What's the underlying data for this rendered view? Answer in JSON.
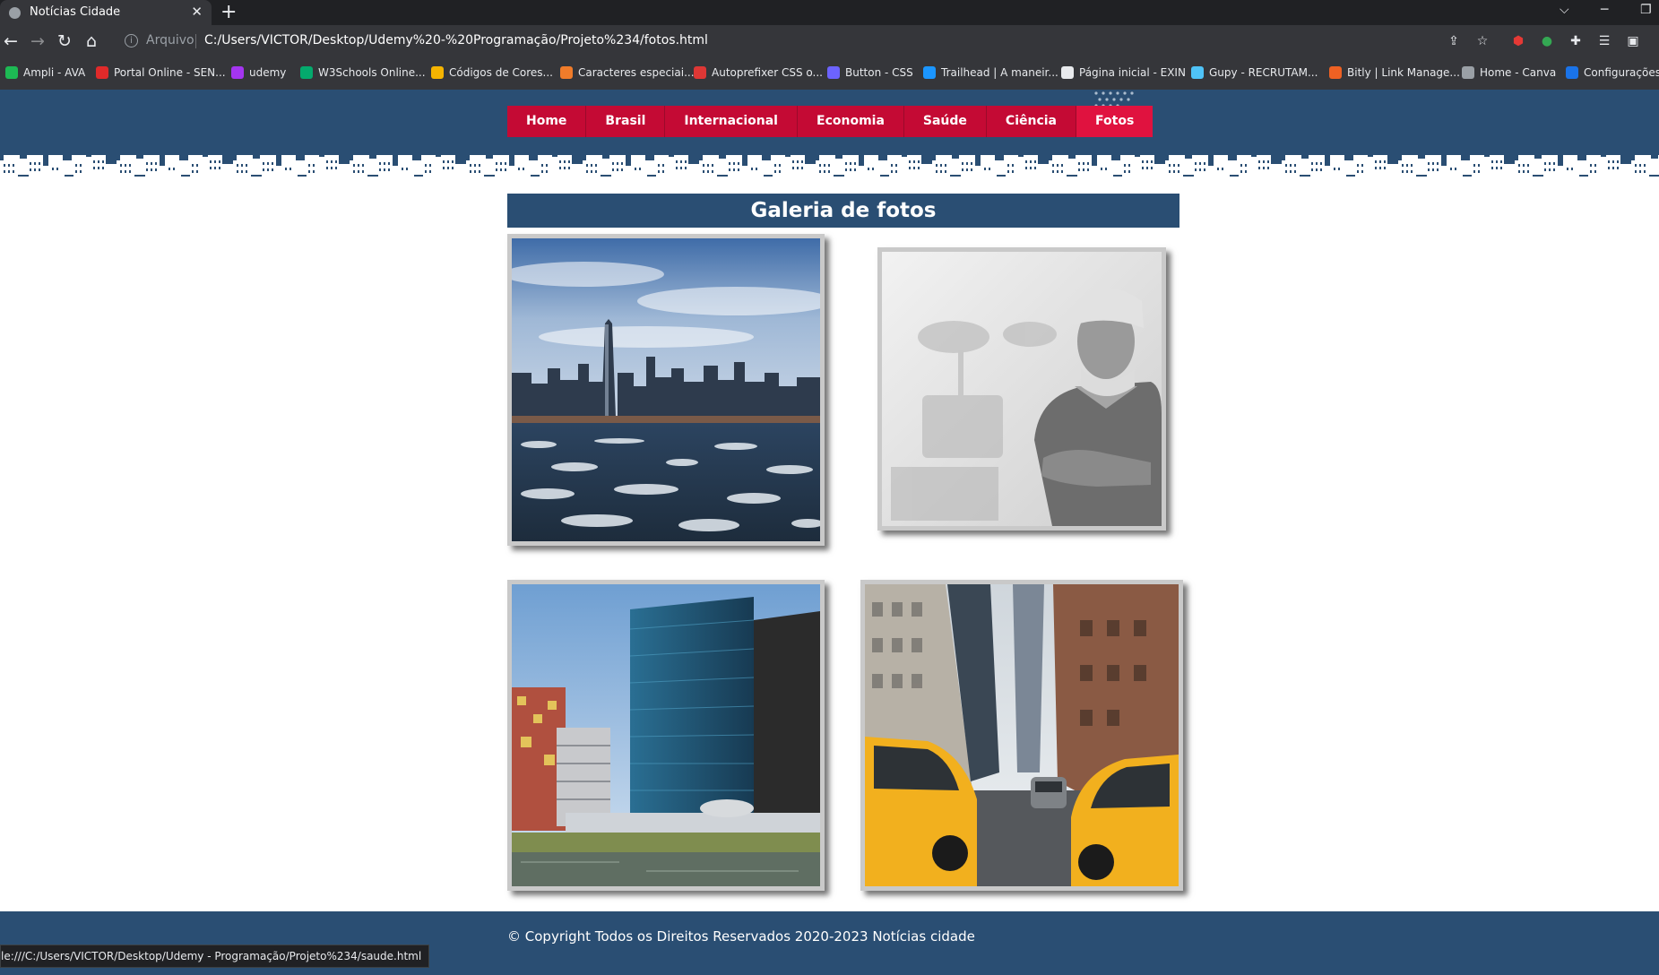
{
  "browser": {
    "tab_title": "Notícias Cidade",
    "tab_close": "✕",
    "new_tab": "+",
    "address_label": "Arquivo",
    "address_url": "C:/Users/VICTOR/Desktop/Udemy%20-%20Programação/Projeto%234/fotos.html",
    "status_url": "le:///C:/Users/VICTOR/Desktop/Udemy - Programação/Projeto%234/saude.html",
    "bookmarks": [
      {
        "label": "Ampli - AVA",
        "color": "#1db954"
      },
      {
        "label": "Portal Online - SEN...",
        "color": "#e02a2a"
      },
      {
        "label": "udemy",
        "color": "#a435f0"
      },
      {
        "label": "W3Schools Online...",
        "color": "#04aa6d"
      },
      {
        "label": "Códigos de Cores...",
        "color": "#f5b400"
      },
      {
        "label": "Caracteres especiai...",
        "color": "#f07c2a"
      },
      {
        "label": "Autoprefixer CSS o...",
        "color": "#dd3735"
      },
      {
        "label": "Button - CSS",
        "color": "#6c63ff"
      },
      {
        "label": "Trailhead | A maneir...",
        "color": "#1b96ff"
      },
      {
        "label": "Página inicial - EXIN",
        "color": "#e8eaed"
      },
      {
        "label": "Gupy - RECRUTAM...",
        "color": "#4fc3f7"
      },
      {
        "label": "Bitly | Link Manage...",
        "color": "#ee6123"
      },
      {
        "label": "Home - Canva",
        "color": "#9aa0a6"
      },
      {
        "label": "Configurações",
        "color": "#1a73e8"
      }
    ]
  },
  "site": {
    "nav": [
      "Home",
      "Brasil",
      "Internacional",
      "Economia",
      "Saúde",
      "Ciência",
      "Fotos"
    ],
    "active_nav": "Fotos",
    "gallery_title": "Galeria de fotos",
    "footer": "© Copyright Todos os Direitos Reservados 2020-2023 Notícias cidade",
    "colors": {
      "header_blue": "#2a4e73",
      "nav_red": "#c40a34",
      "nav_active": "#e0123f"
    },
    "photos": [
      {
        "subject": "city-skyline-over-water"
      },
      {
        "subject": "surgeon-black-and-white"
      },
      {
        "subject": "glass-office-building-waterfront"
      },
      {
        "subject": "yellow-taxis-city-street"
      }
    ]
  }
}
